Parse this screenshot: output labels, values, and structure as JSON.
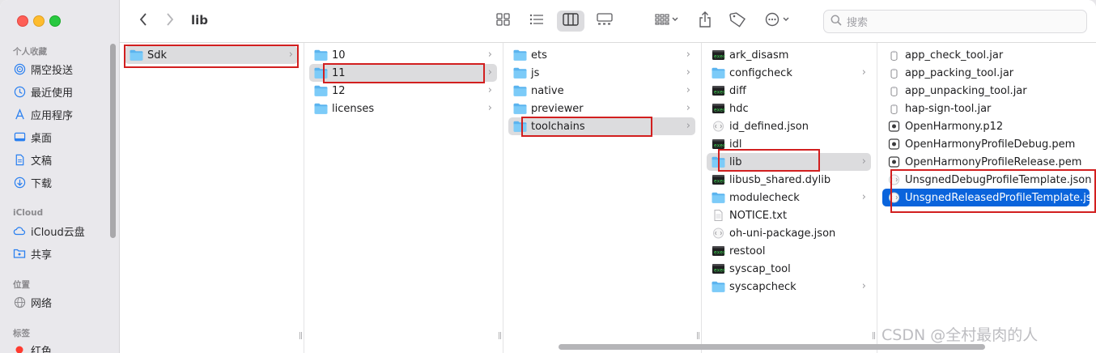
{
  "toolbar": {
    "title": "lib",
    "search_placeholder": "搜索"
  },
  "sidebar": {
    "favorites_header": "个人收藏",
    "favorites": [
      {
        "label": "隔空投送",
        "icon": "airdrop-icon"
      },
      {
        "label": "最近使用",
        "icon": "clock-icon"
      },
      {
        "label": "应用程序",
        "icon": "applications-icon"
      },
      {
        "label": "桌面",
        "icon": "desktop-icon"
      },
      {
        "label": "文稿",
        "icon": "document-icon"
      },
      {
        "label": "下载",
        "icon": "download-icon"
      }
    ],
    "icloud_header": "iCloud",
    "icloud": [
      {
        "label": "iCloud云盘",
        "icon": "cloud-icon"
      },
      {
        "label": "共享",
        "icon": "shared-folder-icon"
      }
    ],
    "locations_header": "位置",
    "locations": [
      {
        "label": "网络",
        "icon": "network-icon"
      }
    ],
    "tags_header": "标签",
    "tags": [
      {
        "label": "红色",
        "color": "#fe3b30"
      }
    ]
  },
  "columns": [
    {
      "items": [
        {
          "label": "Sdk",
          "icon": "folder-icon",
          "has_children": true,
          "state": "path"
        }
      ]
    },
    {
      "items": [
        {
          "label": "10",
          "icon": "folder-icon",
          "has_children": true
        },
        {
          "label": "11",
          "icon": "folder-icon",
          "has_children": true,
          "state": "path"
        },
        {
          "label": "12",
          "icon": "folder-icon",
          "has_children": true
        },
        {
          "label": "licenses",
          "icon": "folder-icon",
          "has_children": true
        }
      ]
    },
    {
      "items": [
        {
          "label": "ets",
          "icon": "folder-icon",
          "has_children": true
        },
        {
          "label": "js",
          "icon": "folder-icon",
          "has_children": true
        },
        {
          "label": "native",
          "icon": "folder-icon",
          "has_children": true
        },
        {
          "label": "previewer",
          "icon": "folder-icon",
          "has_children": true
        },
        {
          "label": "toolchains",
          "icon": "folder-icon",
          "has_children": true,
          "state": "path"
        }
      ]
    },
    {
      "items": [
        {
          "label": "ark_disasm",
          "icon": "executable-icon"
        },
        {
          "label": "configcheck",
          "icon": "folder-icon",
          "has_children": true
        },
        {
          "label": "diff",
          "icon": "executable-icon"
        },
        {
          "label": "hdc",
          "icon": "executable-icon"
        },
        {
          "label": "id_defined.json",
          "icon": "json-file-icon"
        },
        {
          "label": "idl",
          "icon": "executable-icon"
        },
        {
          "label": "lib",
          "icon": "folder-icon",
          "has_children": true,
          "state": "path"
        },
        {
          "label": "libusb_shared.dylib",
          "icon": "executable-icon"
        },
        {
          "label": "modulecheck",
          "icon": "folder-icon",
          "has_children": true
        },
        {
          "label": "NOTICE.txt",
          "icon": "text-file-icon"
        },
        {
          "label": "oh-uni-package.json",
          "icon": "json-file-icon"
        },
        {
          "label": "restool",
          "icon": "executable-icon"
        },
        {
          "label": "syscap_tool",
          "icon": "executable-icon"
        },
        {
          "label": "syscapcheck",
          "icon": "folder-icon",
          "has_children": true
        }
      ]
    },
    {
      "items": [
        {
          "label": "app_check_tool.jar",
          "icon": "jar-file-icon"
        },
        {
          "label": "app_packing_tool.jar",
          "icon": "jar-file-icon"
        },
        {
          "label": "app_unpacking_tool.jar",
          "icon": "jar-file-icon"
        },
        {
          "label": "hap-sign-tool.jar",
          "icon": "jar-file-icon"
        },
        {
          "label": "OpenHarmony.p12",
          "icon": "certificate-icon"
        },
        {
          "label": "OpenHarmonyProfileDebug.pem",
          "icon": "certificate-icon"
        },
        {
          "label": "OpenHarmonyProfileRelease.pem",
          "icon": "certificate-icon"
        },
        {
          "label": "UnsgnedDebugProfileTemplate.json",
          "icon": "json-file-icon"
        },
        {
          "label": "UnsgnedReleasedProfileTemplate.json",
          "icon": "json-file-icon",
          "state": "selected"
        }
      ]
    }
  ],
  "colors": {
    "selection_blue": "#0a64dc",
    "highlight_red": "#d21f1f",
    "folder_blue": "#6cc0f5"
  },
  "watermark": "CSDN @全村最肉的人"
}
